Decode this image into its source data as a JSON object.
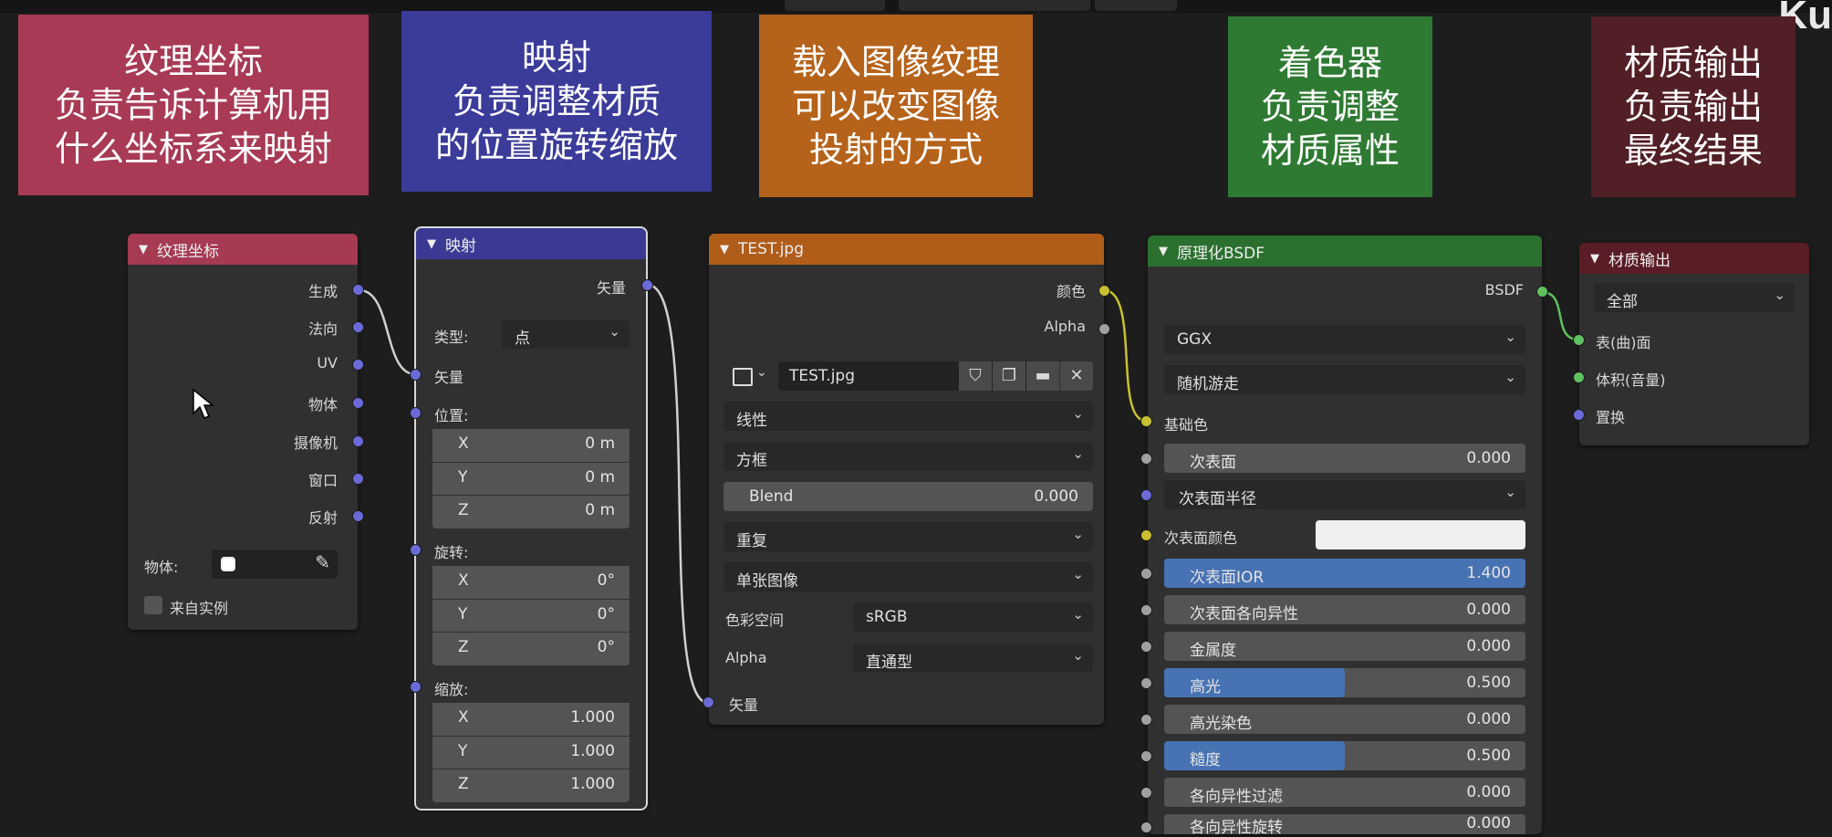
{
  "brand": "Ku",
  "banners": [
    {
      "text": "纹理坐标\n负责告诉计算机用\n什么坐标系来映射",
      "color": "#a83a55"
    },
    {
      "text": "映射\n负责调整材质\n的位置旋转缩放",
      "color": "#3b3b9a"
    },
    {
      "text": "载入图像纹理\n可以改变图像\n投射的方式",
      "color": "#b5621a"
    },
    {
      "text": "着色器\n负责调整\n材质属性",
      "color": "#2f7a33"
    },
    {
      "text": "材质输出\n负责输出\n最终结果",
      "color": "#521f26"
    }
  ],
  "texcoord": {
    "title": "纹理坐标",
    "outputs": [
      "生成",
      "法向",
      "UV",
      "物体",
      "摄像机",
      "窗口",
      "反射"
    ],
    "object_label": "物体:",
    "from_instancer": "来自实例"
  },
  "mapping": {
    "title": "映射",
    "out_vector": "矢量",
    "type_label": "类型:",
    "type_value": "点",
    "in_vector": "矢量",
    "location_label": "位置:",
    "location": [
      {
        "axis": "X",
        "value": "0 m"
      },
      {
        "axis": "Y",
        "value": "0 m"
      },
      {
        "axis": "Z",
        "value": "0 m"
      }
    ],
    "rotation_label": "旋转:",
    "rotation": [
      {
        "axis": "X",
        "value": "0°"
      },
      {
        "axis": "Y",
        "value": "0°"
      },
      {
        "axis": "Z",
        "value": "0°"
      }
    ],
    "scale_label": "缩放:",
    "scale": [
      {
        "axis": "X",
        "value": "1.000"
      },
      {
        "axis": "Y",
        "value": "1.000"
      },
      {
        "axis": "Z",
        "value": "1.000"
      }
    ]
  },
  "image": {
    "title": "TEST.jpg",
    "out_color": "颜色",
    "out_alpha": "Alpha",
    "image_name": "TEST.jpg",
    "interpolation": "线性",
    "projection": "方框",
    "blend_label": "Blend",
    "blend_value": "0.000",
    "extension": "重复",
    "source": "单张图像",
    "colorspace_label": "色彩空间",
    "colorspace_value": "sRGB",
    "alpha_label": "Alpha",
    "alpha_value": "直通型",
    "in_vector": "矢量"
  },
  "bsdf": {
    "title": "原理化BSDF",
    "out_bsdf": "BSDF",
    "distribution": "GGX",
    "subsurface_method": "随机游走",
    "base_color": "基础色",
    "subsurface": {
      "label": "次表面",
      "value": "0.000"
    },
    "subsurface_radius": "次表面半径",
    "subsurface_color": "次表面颜色",
    "subsurface_ior": {
      "label": "次表面IOR",
      "value": "1.400",
      "fill": 1.0
    },
    "subsurface_aniso": {
      "label": "次表面各向异性",
      "value": "0.000"
    },
    "metallic": {
      "label": "金属度",
      "value": "0.000"
    },
    "specular": {
      "label": "高光",
      "value": "0.500",
      "fill": 0.5
    },
    "specular_tint": {
      "label": "高光染色",
      "value": "0.000"
    },
    "roughness": {
      "label": "糙度",
      "value": "0.500",
      "fill": 0.5
    },
    "anisotropic": {
      "label": "各向异性过滤",
      "value": "0.000"
    },
    "anisotropic_rot": {
      "label": "各向异性旋转",
      "value": "0.000"
    }
  },
  "output": {
    "title": "材质输出",
    "target": "全部",
    "in_surface": "表(曲)面",
    "in_volume": "体积(音量)",
    "in_displacement": "置换"
  },
  "colors": {
    "texcoord_header": "#a53a52",
    "mapping_header": "#3a3a94",
    "image_header": "#b05d1a",
    "bsdf_header": "#2c7030",
    "output_header": "#5a1c25",
    "slider_fill": "#4772b3",
    "vector_socket": "#6a6ad8",
    "color_socket": "#c8c030",
    "float_socket": "#a0a0a0",
    "shader_socket": "#5fc15f"
  }
}
